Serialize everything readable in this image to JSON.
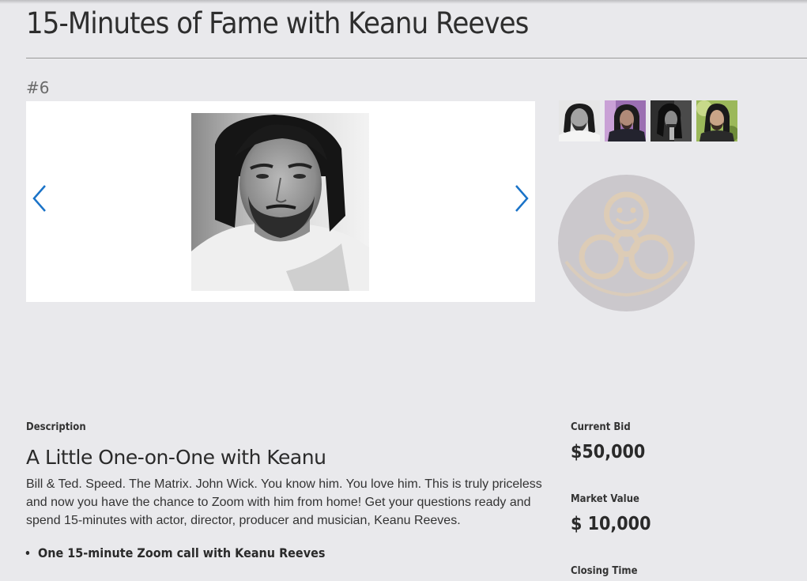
{
  "page": {
    "title": "15-Minutes of Fame with Keanu Reeves",
    "lot_number": "#6"
  },
  "gallery": {
    "thumbnails": [
      {
        "name": "keanu-portrait-white-shirt"
      },
      {
        "name": "keanu-purple-background"
      },
      {
        "name": "keanu-dark-profile"
      },
      {
        "name": "keanu-green-background"
      }
    ],
    "prev_icon": "chevron-left-icon",
    "next_icon": "chevron-right-icon",
    "badge_icon": "biohazard-smiley-icon",
    "colors": {
      "arrow": "#1a73c8",
      "badge_circle": "#cbc8cc",
      "badge_symbol": "#e0cdb4"
    }
  },
  "description": {
    "label": "Description",
    "heading": "A Little One-on-One with Keanu",
    "body": "Bill & Ted. Speed. The Matrix. John Wick. You know him. You love him. This is truly priceless and now you have the chance to Zoom with him from home! Get your questions ready and spend 15-minutes with actor, director, producer and musician, Keanu Reeves.",
    "bullets": [
      "One 15-minute Zoom call with Keanu Reeves"
    ]
  },
  "bid": {
    "current_bid_label": "Current Bid",
    "current_bid_value": "$50,000",
    "market_value_label": "Market Value",
    "market_value_value": "$ 10,000",
    "closing_time_label": "Closing Time"
  }
}
